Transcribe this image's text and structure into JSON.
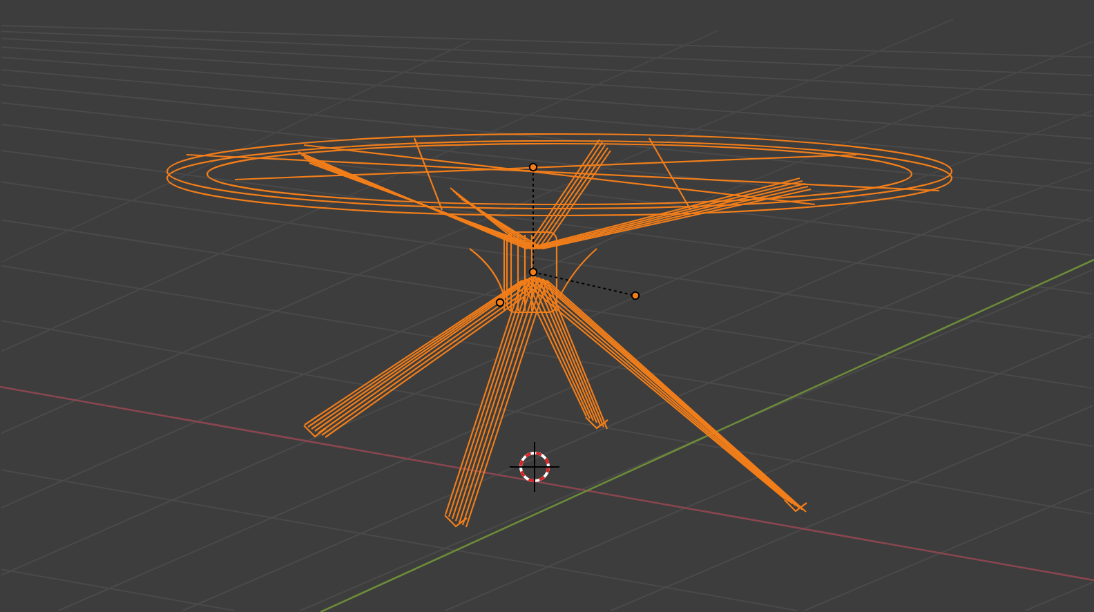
{
  "viewport": {
    "objects": [
      {
        "kind": "table",
        "selected": true
      }
    ]
  }
}
